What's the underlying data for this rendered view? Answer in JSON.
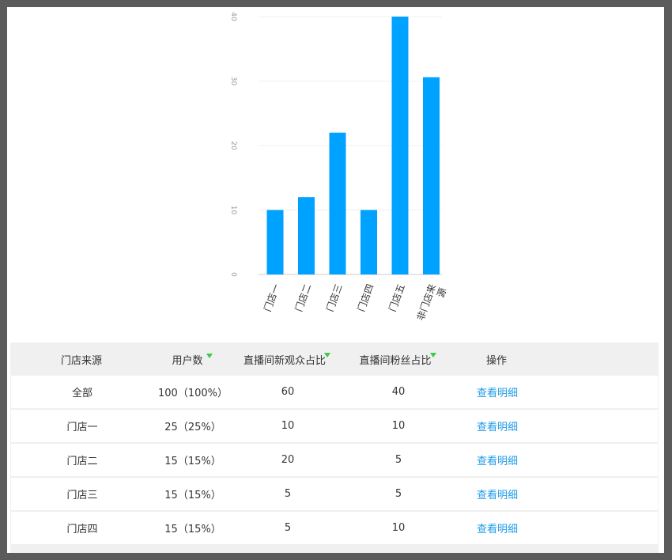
{
  "chart_data": {
    "type": "bar",
    "categories": [
      "门店一",
      "门店二",
      "门店三",
      "门店四",
      "门店五",
      "非门店来源"
    ],
    "values": [
      10,
      12,
      22,
      10,
      40,
      30.6
    ],
    "ylim": [
      0,
      40
    ],
    "yticks": [
      0,
      10,
      20,
      30,
      40
    ],
    "grid": true,
    "bar_color": "#00a2ff"
  },
  "table": {
    "headers": [
      "门店来源",
      "用户数",
      "直播间新观众占比",
      "直播间粉丝占比",
      "操作"
    ],
    "rows": [
      {
        "source": "全部",
        "users": "100（100%）",
        "new_ratio": "60",
        "fan_ratio": "40",
        "action": "查看明细"
      },
      {
        "source": "门店一",
        "users": "25（25%）",
        "new_ratio": "10",
        "fan_ratio": "10",
        "action": "查看明细"
      },
      {
        "source": "门店二",
        "users": "15（15%）",
        "new_ratio": "20",
        "fan_ratio": "5",
        "action": "查看明细"
      },
      {
        "source": "门店三",
        "users": "15（15%）",
        "new_ratio": "5",
        "fan_ratio": "5",
        "action": "查看明细"
      },
      {
        "source": "门店四",
        "users": "15（15%）",
        "new_ratio": "5",
        "fan_ratio": "10",
        "action": "查看明细"
      }
    ]
  },
  "colors": {
    "link": "#1e9be9",
    "sort_icon": "#3ec94a",
    "header_bg": "#f0f0f0"
  }
}
